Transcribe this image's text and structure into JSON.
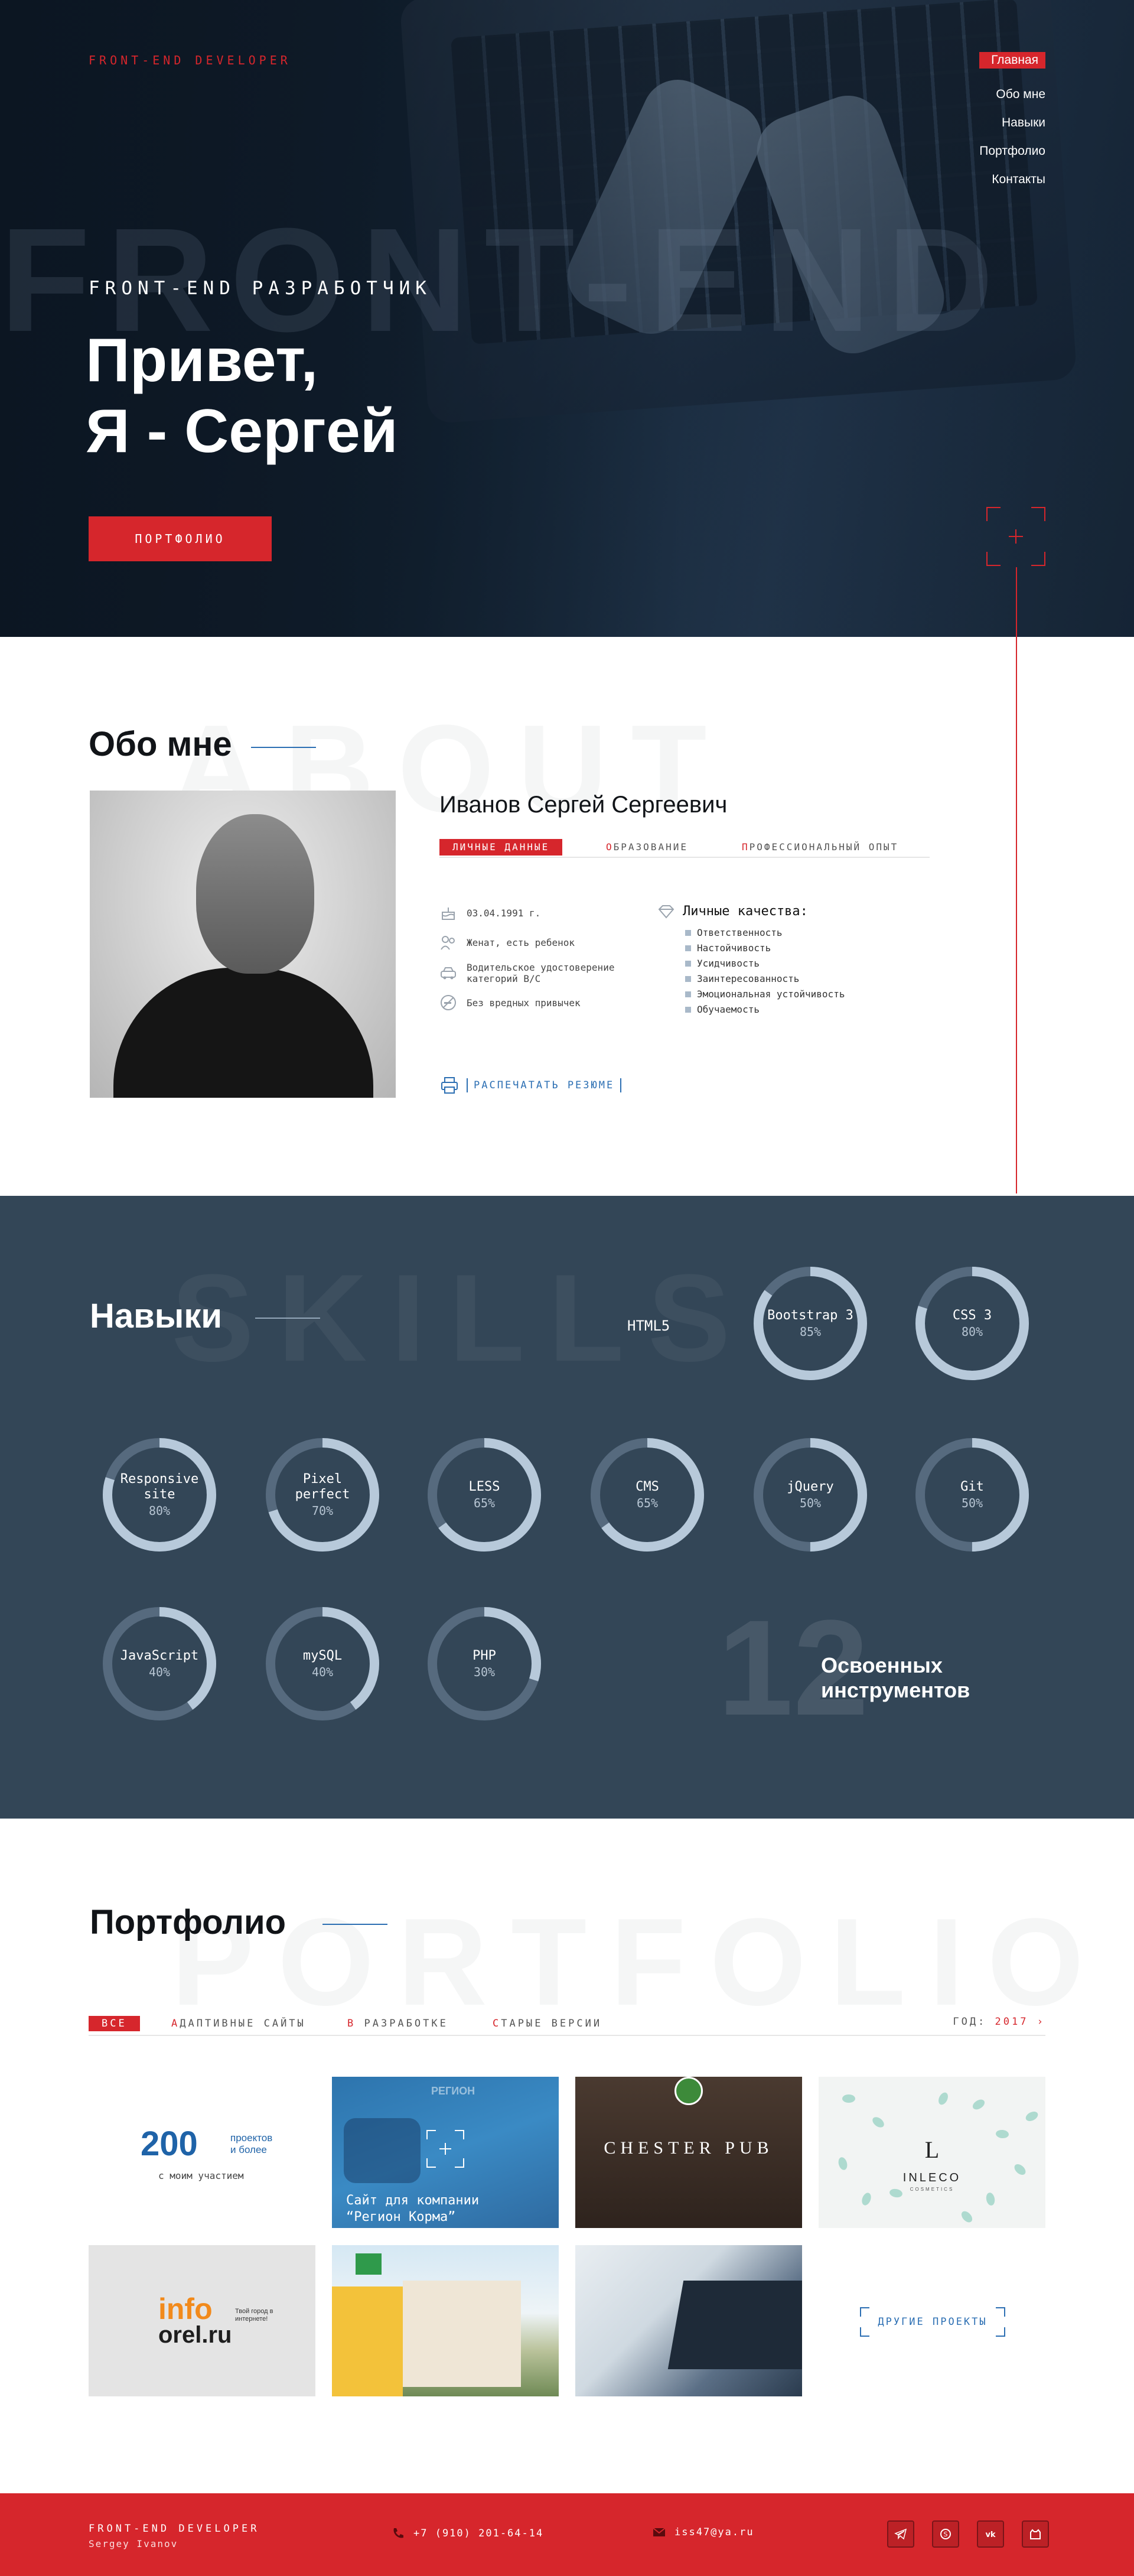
{
  "header": {
    "brand": "FRONT-END DEVELOPER",
    "nav": [
      "Главная",
      "Обо мне",
      "Навыки",
      "Портфолио",
      "Контакты"
    ],
    "bg_word": "FRONT-END",
    "subtitle": "FRONT-END РАЗРАБОТЧИК",
    "title_line1": "Привет,",
    "title_line2": "Я - Сергей",
    "cta": "ПОРТФОЛИО"
  },
  "about": {
    "title": "Обо мне",
    "bg_word": "ABOUT",
    "name": "Иванов Сергей Сергеевич",
    "tabs": [
      "ЛИЧНЫЕ ДАННЫЕ",
      "ОБРАЗОВАНИЕ",
      "ПРОФЕССИОНАЛЬНЫЙ ОПЫТ"
    ],
    "details": [
      "03.04.1991 г.",
      "Женат, есть ребенок",
      "Водительское удостоверение категорий B/C",
      "Без вредных привычек"
    ],
    "qualities_title": "Личные качества:",
    "qualities": [
      "Ответственность",
      "Настойчивость",
      "Усидчивость",
      "Заинтересованность",
      "Эмоциональная устойчивость",
      "Обучаемость"
    ],
    "print_label": "РАСПЕЧАТАТЬ РЕЗЮМЕ"
  },
  "skills": {
    "title": "Навыки",
    "bg_word": "SKILLS",
    "html_label": "HTML5",
    "items": [
      {
        "name": "Bootstrap 3",
        "percent": 85
      },
      {
        "name": "CSS 3",
        "percent": 80
      },
      {
        "name": "Responsive site",
        "percent": 80
      },
      {
        "name": "Pixel perfect",
        "percent": 70
      },
      {
        "name": "LESS",
        "percent": 65
      },
      {
        "name": "CMS",
        "percent": 65
      },
      {
        "name": "jQuery",
        "percent": 50
      },
      {
        "name": "Git",
        "percent": 50
      },
      {
        "name": "JavaScript",
        "percent": 40
      },
      {
        "name": "mySQL",
        "percent": 40
      },
      {
        "name": "PHP",
        "percent": 30
      }
    ],
    "pct_labels": [
      "85%",
      "80%",
      "80%",
      "70%",
      "65%",
      "65%",
      "50%",
      "50%",
      "40%",
      "40%",
      "30%"
    ],
    "count": "12",
    "count_label_1": "Освоенных",
    "count_label_2": "инструментов",
    "colors": {
      "ring_track": "#566a7e",
      "ring_fill": "#b7c9da"
    }
  },
  "portfolio": {
    "title": "Портфолио",
    "bg_word": "PORTFOLIO",
    "filters": [
      "ВСЕ",
      "АДАПТИВНЫЕ САЙТЫ",
      "В РАЗРАБОТКЕ",
      "СТАРЫЕ ВЕРСИИ"
    ],
    "year_label": "ГОД:",
    "year_value": "2017",
    "count_num": "200",
    "count_text_1": "проектов",
    "count_text_2": "и более",
    "count_sub": "с моим участием",
    "region_logo": "РЕГИОН",
    "region_caption_1": "Сайт для компании",
    "region_caption_2": "“Регион Корма”",
    "chester_title": "CHESTER PUB",
    "inleco_brand": "INLECO",
    "inleco_sub": "COSMETICS",
    "info_logo": "info",
    "orel_logo": "orel.ru",
    "info_tag": "Твой город в интернете!",
    "other_projects": "ДРУГИЕ ПРОЕКТЫ"
  },
  "footer": {
    "brand": "FRONT-END DEVELOPER",
    "name": "Sergey Ivanov",
    "phone": "+7 (910) 201-64-14",
    "email": "iss47@ya.ru"
  },
  "colors": {
    "accent": "#d6262c",
    "link": "#2c6fb3",
    "dark": "#334657"
  }
}
